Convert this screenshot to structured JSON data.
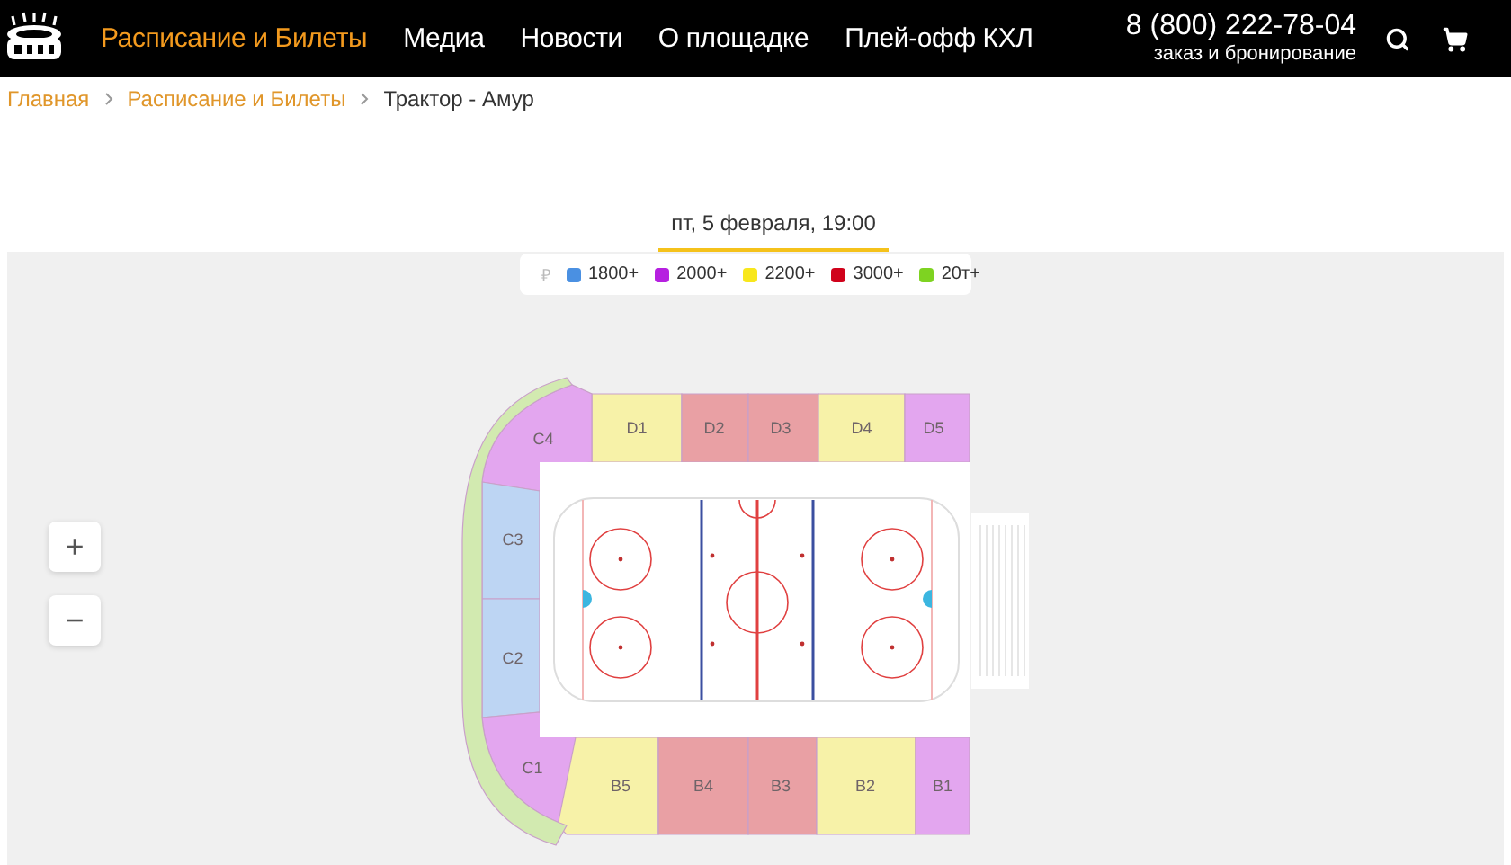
{
  "header": {
    "nav": [
      {
        "label": "Расписание и Билеты",
        "selected": true
      },
      {
        "label": "Медиа",
        "selected": false
      },
      {
        "label": "Новости",
        "selected": false
      },
      {
        "label": "О площадке",
        "selected": false
      },
      {
        "label": "Плей-офф КХЛ",
        "selected": false
      }
    ],
    "phone": "8 (800) 222-78-04",
    "phone_note": "заказ и бронирование"
  },
  "breadcrumbs": [
    {
      "label": "Главная",
      "kind": "link"
    },
    {
      "label": "Расписание и Билеты",
      "kind": "link"
    },
    {
      "label": "Трактор - Амур",
      "kind": "current"
    }
  ],
  "event": {
    "date": "пт, 5 февраля, 19:00"
  },
  "legend": {
    "currency": "₽",
    "items": [
      {
        "label": "1800+",
        "color": "#4a90e2"
      },
      {
        "label": "2000+",
        "color": "#b620e0"
      },
      {
        "label": "2200+",
        "color": "#f8e71c"
      },
      {
        "label": "3000+",
        "color": "#d0021b"
      },
      {
        "label": "20т+",
        "color": "#7ed321"
      }
    ]
  },
  "zoom": {
    "in": "+",
    "out": "−"
  },
  "sectors": [
    {
      "label": "D1",
      "color": "#f7f2a8"
    },
    {
      "label": "D2",
      "color": "#e9a0a4"
    },
    {
      "label": "D3",
      "color": "#e9a0a4"
    },
    {
      "label": "D4",
      "color": "#f7f2a8"
    },
    {
      "label": "D5",
      "color": "#e3a6ef"
    },
    {
      "label": "C4",
      "color": "#e3a6ef"
    },
    {
      "label": "C3",
      "color": "#bdd5f3"
    },
    {
      "label": "C2",
      "color": "#bdd5f3"
    },
    {
      "label": "C1",
      "color": "#e3a6ef"
    },
    {
      "label": "B5",
      "color": "#f7f2a8"
    },
    {
      "label": "B4",
      "color": "#e9a0a4"
    },
    {
      "label": "B3",
      "color": "#e9a0a4"
    },
    {
      "label": "B2",
      "color": "#f7f2a8"
    },
    {
      "label": "B1",
      "color": "#e3a6ef"
    },
    {
      "color": "#d2eab0"
    }
  ]
}
